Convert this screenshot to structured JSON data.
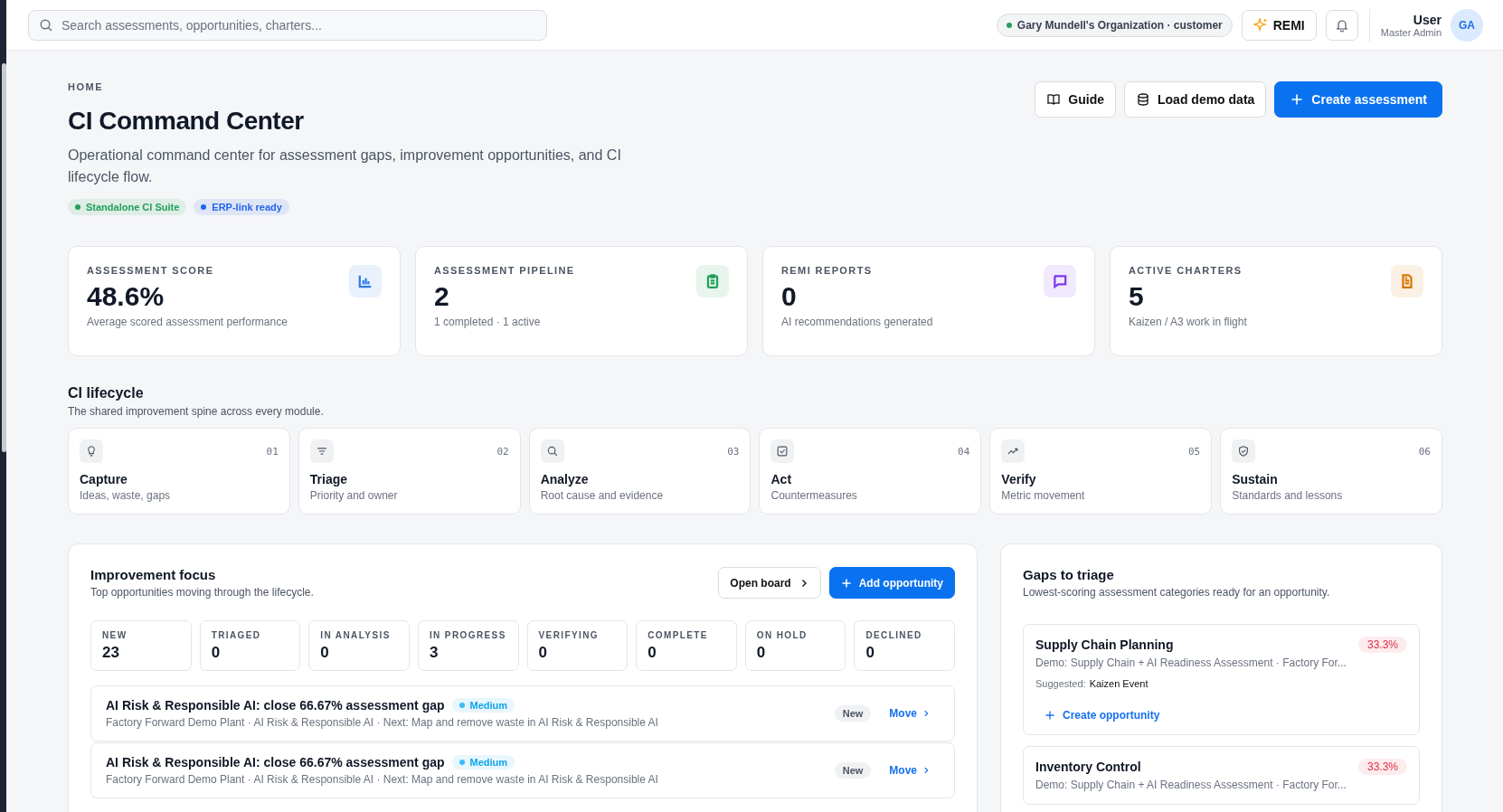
{
  "topbar": {
    "search": {
      "placeholder": "Search assessments, opportunities, charters..."
    },
    "org": "Gary Mundell's Organization · customer",
    "remi": "REMI",
    "user": {
      "name": "User",
      "role": "Master Admin",
      "initials": "GA"
    }
  },
  "header": {
    "breadcrumb": "HOME",
    "title": "CI Command Center",
    "description": "Operational command center for assessment gaps, improvement opportunities, and CI lifecycle flow.",
    "tags": [
      {
        "label": "Standalone CI Suite",
        "color": "#22a05a"
      },
      {
        "label": "ERP-link ready",
        "color": "#2563eb"
      }
    ],
    "buttons": [
      {
        "label": "Guide",
        "kind": "book"
      },
      {
        "label": "Load demo data",
        "kind": "database"
      },
      {
        "label": "Create assessment",
        "kind": "primary"
      }
    ]
  },
  "stats": [
    {
      "label": "ASSESSMENT SCORE",
      "value": "48.6%",
      "caption": "Average scored assessment performance",
      "kind": "chart",
      "color": "#2f7be8"
    },
    {
      "label": "ASSESSMENT PIPELINE",
      "value": "2",
      "caption": "1 completed · 1 active",
      "kind": "clipboard",
      "color": "#22a05a"
    },
    {
      "label": "REMI REPORTS",
      "value": "0",
      "caption": "AI recommendations generated",
      "kind": "message",
      "color": "#7c3aed"
    },
    {
      "label": "ACTIVE CHARTERS",
      "value": "5",
      "caption": "Kaizen / A3 work in flight",
      "kind": "document",
      "color": "#d97706"
    }
  ],
  "lifecycle": {
    "title": "CI lifecycle",
    "subtitle": "The shared improvement spine across every module.",
    "steps": [
      {
        "number": "01",
        "name": "Capture",
        "caption": "Ideas, waste, gaps",
        "kind": "bulb"
      },
      {
        "number": "02",
        "name": "Triage",
        "caption": "Priority and owner",
        "kind": "filter"
      },
      {
        "number": "03",
        "name": "Analyze",
        "caption": "Root cause and evidence",
        "kind": "search"
      },
      {
        "number": "04",
        "name": "Act",
        "caption": "Countermeasures",
        "kind": "check"
      },
      {
        "number": "05",
        "name": "Verify",
        "caption": "Metric movement",
        "kind": "trend"
      },
      {
        "number": "06",
        "name": "Sustain",
        "caption": "Standards and lessons",
        "kind": "shield"
      }
    ]
  },
  "focus": {
    "title": "Improvement focus",
    "subtitle": "Top opportunities moving through the lifecycle.",
    "open_board": "Open board",
    "add": "Add opportunity",
    "counts": [
      {
        "label": "NEW",
        "value": "23"
      },
      {
        "label": "TRIAGED",
        "value": "0"
      },
      {
        "label": "IN ANALYSIS",
        "value": "0"
      },
      {
        "label": "IN PROGRESS",
        "value": "3"
      },
      {
        "label": "VERIFYING",
        "value": "0"
      },
      {
        "label": "COMPLETE",
        "value": "0"
      },
      {
        "label": "ON HOLD",
        "value": "0"
      },
      {
        "label": "DECLINED",
        "value": "0"
      }
    ],
    "items": [
      {
        "title": "AI Risk & Responsible AI: close 66.67% assessment gap",
        "priority": "Medium",
        "details": "Factory Forward Demo Plant · AI Risk & Responsible AI · Next: Map and remove waste in AI Risk & Responsible AI",
        "status": "New",
        "action": "Move"
      },
      {
        "title": "AI Risk & Responsible AI: close 66.67% assessment gap",
        "priority": "Medium",
        "details": "Factory Forward Demo Plant · AI Risk & Responsible AI · Next: Map and remove waste in AI Risk & Responsible AI",
        "status": "New",
        "action": "Move"
      }
    ]
  },
  "gaps": {
    "title": "Gaps to triage",
    "subtitle": "Lowest-scoring assessment categories ready for an opportunity.",
    "items": [
      {
        "name": "Supply Chain Planning",
        "score": "33.3%",
        "source": "Demo: Supply Chain + AI Readiness Assessment · Factory For...",
        "suggested_label": "Suggested:",
        "suggested": "Kaizen Event",
        "action": "Create opportunity"
      },
      {
        "name": "Inventory Control",
        "score": "33.3%",
        "source": "Demo: Supply Chain + AI Readiness Assessment · Factory For..."
      }
    ]
  }
}
